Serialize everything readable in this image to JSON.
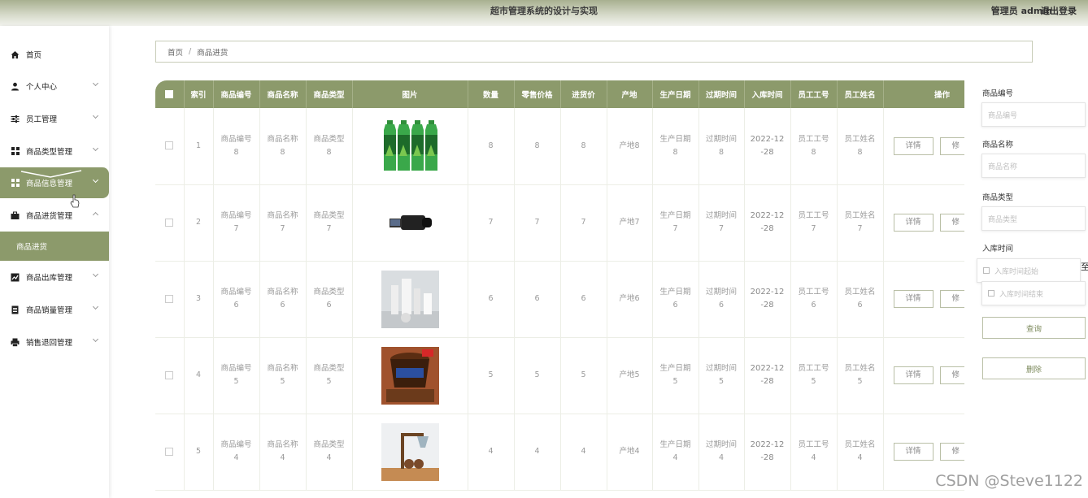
{
  "header": {
    "title": "超市管理系统的设计与实现",
    "user": "管理员 admin",
    "logout": "退出登录"
  },
  "sidebar": {
    "items": [
      {
        "label": "首页"
      },
      {
        "label": "个人中心"
      },
      {
        "label": "员工管理"
      },
      {
        "label": "商品类型管理"
      },
      {
        "label": "商品信息管理"
      },
      {
        "label": "商品进货管理"
      },
      {
        "label": "商品进货"
      },
      {
        "label": "商品出库管理"
      },
      {
        "label": "商品销量管理"
      },
      {
        "label": "销售退回管理"
      }
    ]
  },
  "breadcrumb": {
    "home": "首页",
    "sep": "/",
    "current": "商品进货"
  },
  "table": {
    "columns": [
      "索引",
      "商品编号",
      "商品名称",
      "商品类型",
      "图片",
      "数量",
      "零售价格",
      "进货价",
      "产地",
      "生产日期",
      "过期时间",
      "入库时间",
      "员工工号",
      "员工姓名",
      "操作"
    ],
    "rows": [
      {
        "index": "1",
        "code": "商品编号",
        "code_n": "8",
        "name": "商品名称",
        "name_n": "8",
        "type": "商品类型",
        "type_n": "8",
        "image": "aloe-drink-bottles",
        "qty": "8",
        "retail": "8",
        "cost": "8",
        "origin": "产地8",
        "mfg": "生产日期",
        "mfg_n": "8",
        "exp": "过期时间",
        "exp_n": "8",
        "in_time_a": "2022-12",
        "in_time_b": "-28",
        "emp_no": "员工工号",
        "emp_no_n": "8",
        "emp_name": "员工姓名",
        "emp_name_n": "8",
        "detail": "详情",
        "edit": "修"
      },
      {
        "index": "2",
        "code": "商品编号",
        "code_n": "7",
        "name": "商品名称",
        "name_n": "7",
        "type": "商品类型",
        "type_n": "7",
        "image": "camcorder",
        "qty": "7",
        "retail": "7",
        "cost": "7",
        "origin": "产地7",
        "mfg": "生产日期",
        "mfg_n": "7",
        "exp": "过期时间",
        "exp_n": "7",
        "in_time_a": "2022-12",
        "in_time_b": "-28",
        "emp_no": "员工工号",
        "emp_no_n": "7",
        "emp_name": "员工姓名",
        "emp_name_n": "7",
        "detail": "详情",
        "edit": "修"
      },
      {
        "index": "3",
        "code": "商品编号",
        "code_n": "6",
        "name": "商品名称",
        "name_n": "6",
        "type": "商品类型",
        "type_n": "6",
        "image": "appliances",
        "qty": "6",
        "retail": "6",
        "cost": "6",
        "origin": "产地6",
        "mfg": "生产日期",
        "mfg_n": "6",
        "exp": "过期时间",
        "exp_n": "6",
        "in_time_a": "2022-12",
        "in_time_b": "-28",
        "emp_no": "员工工号",
        "emp_no_n": "6",
        "emp_name": "员工姓名",
        "emp_name_n": "6",
        "detail": "详情",
        "edit": "修"
      },
      {
        "index": "4",
        "code": "商品编号",
        "code_n": "5",
        "name": "商品名称",
        "name_n": "5",
        "type": "商品类型",
        "type_n": "5",
        "image": "ice-cream-tub",
        "qty": "5",
        "retail": "5",
        "cost": "5",
        "origin": "产地5",
        "mfg": "生产日期",
        "mfg_n": "5",
        "exp": "过期时间",
        "exp_n": "5",
        "in_time_a": "2022-12",
        "in_time_b": "-28",
        "emp_no": "员工工号",
        "emp_no_n": "5",
        "emp_name": "员工姓名",
        "emp_name_n": "5",
        "detail": "详情",
        "edit": "修"
      },
      {
        "index": "5",
        "code": "商品编号",
        "code_n": "4",
        "name": "商品名称",
        "name_n": "4",
        "type": "商品类型",
        "type_n": "4",
        "image": "desk-lamp",
        "qty": "4",
        "retail": "4",
        "cost": "4",
        "origin": "产地4",
        "mfg": "生产日期",
        "mfg_n": "4",
        "exp": "过期时间",
        "exp_n": "4",
        "in_time_a": "2022-12",
        "in_time_b": "-28",
        "emp_no": "员工工号",
        "emp_no_n": "4",
        "emp_name": "员工姓名",
        "emp_name_n": "4",
        "detail": "详情",
        "edit": "修"
      }
    ]
  },
  "search": {
    "code_label": "商品编号",
    "code_placeholder": "商品编号",
    "name_label": "商品名称",
    "name_placeholder": "商品名称",
    "type_label": "商品类型",
    "type_placeholder": "商品类型",
    "time_label": "入库时间",
    "time_start": "入库时间起始",
    "time_end": "入库时间结束",
    "to": "至",
    "query_button": "查询",
    "delete_button": "删除"
  },
  "watermark": "CSDN @Steve1122",
  "colors": {
    "accent": "#8c9a6b"
  }
}
